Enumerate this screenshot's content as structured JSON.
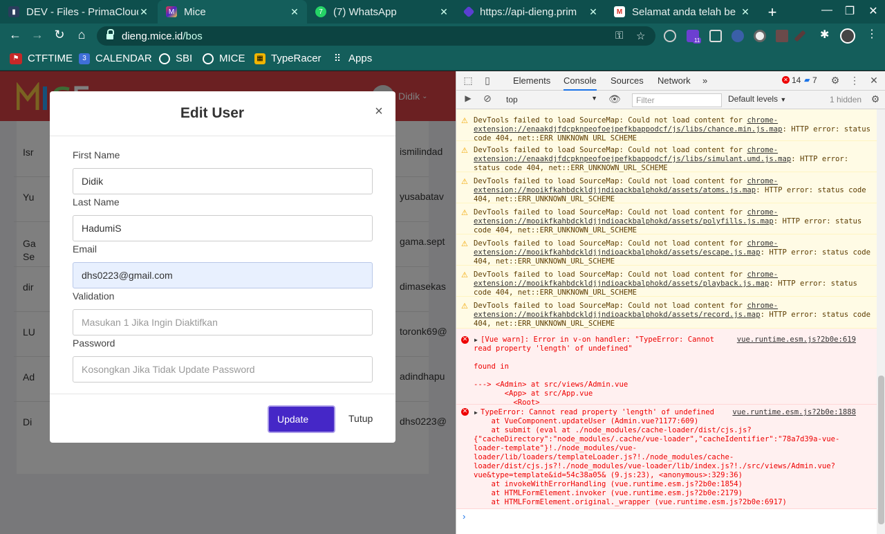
{
  "browser": {
    "tabs": [
      {
        "title": "DEV - Files - PrimaCloud",
        "favicon": "primacloud-icon",
        "active": false
      },
      {
        "title": "Mice",
        "favicon": "mice-logo-icon",
        "active": true
      },
      {
        "title": "(7) WhatsApp",
        "favicon": "whatsapp-icon",
        "active": false
      },
      {
        "title": "https://api-dieng.prim",
        "favicon": "api-icon",
        "active": false
      },
      {
        "title": "Selamat anda telah be",
        "favicon": "gmail-icon",
        "active": false
      }
    ],
    "new_tab": "+",
    "window_controls": {
      "minimize": "—",
      "maximize": "❐",
      "close": "✕"
    },
    "url_host": "dieng.mice.id",
    "url_path": "/bos",
    "extension_badge": "11",
    "bookmarks": [
      {
        "label": "CTFTIME",
        "icon": "ctftime-icon"
      },
      {
        "label": "CALENDAR",
        "icon": "calendar-icon",
        "badge": "3"
      },
      {
        "label": "SBI",
        "icon": "globe-icon"
      },
      {
        "label": "MICE",
        "icon": "globe-icon"
      },
      {
        "label": "TypeRacer",
        "icon": "typeracer-icon"
      },
      {
        "label": "Apps",
        "icon": "apps-grid-icon"
      }
    ]
  },
  "app": {
    "user_name": "Didik",
    "table_rows": [
      {
        "name": "Isr",
        "email": "ismilindad"
      },
      {
        "name": "Yu",
        "email": "yusabatav"
      },
      {
        "name": "Ga Se",
        "email": "gama.sept"
      },
      {
        "name": "dir",
        "email": "dimasekas"
      },
      {
        "name": "LU",
        "email": "toronk69@"
      },
      {
        "name": "Ad",
        "email": "adindhapu"
      },
      {
        "name": "Di",
        "email": "dhs0223@"
      }
    ]
  },
  "modal": {
    "title": "Edit User",
    "close": "×",
    "first_name_label": "First Name",
    "first_name_value": "Didik",
    "last_name_label": "Last Name",
    "last_name_value": "HadumiS",
    "email_label": "Email",
    "email_value": "dhs0223@gmail.com",
    "validation_label": "Validation",
    "validation_placeholder": "Masukan 1 Jika Ingin Diaktifkan",
    "password_label": "Password",
    "password_placeholder": "Kosongkan Jika Tidak Update Password",
    "update_button": "Update",
    "close_button": "Tutup"
  },
  "devtools": {
    "tabs": [
      "Elements",
      "Console",
      "Sources",
      "Network"
    ],
    "active_tab": "Console",
    "more_tabs": "»",
    "error_count": "14",
    "message_count": "7",
    "context": "top",
    "filter_placeholder": "Filter",
    "levels": "Default levels",
    "hidden": "1 hidden",
    "warnings": [
      {
        "text": "DevTools failed to load SourceMap: Could not load content for ",
        "link": "chrome-extension://enaakdjfdcpknpeofoejpefkbappodcf/js/libs/chance.min.js.map",
        "tail": ": HTTP error: status code 404, net::ERR_UNKNOWN_URL_SCHEME"
      },
      {
        "text": "DevTools failed to load SourceMap: Could not load content for ",
        "link": "chrome-extension://enaakdjfdcpknpeofoejpefkbappodcf/js/libs/simulant.umd.js.map",
        "tail": ": HTTP error: status code 404, net::ERR_UNKNOWN_URL_SCHEME"
      },
      {
        "text": "DevTools failed to load SourceMap: Could not load content for ",
        "link": "chrome-extension://mooikfkahbdckldjjndioackbalphokd/assets/atoms.js.map",
        "tail": ": HTTP error: status code 404, net::ERR_UNKNOWN_URL_SCHEME"
      },
      {
        "text": "DevTools failed to load SourceMap: Could not load content for ",
        "link": "chrome-extension://mooikfkahbdckldjjndioackbalphokd/assets/polyfills.js.map",
        "tail": ": HTTP error: status code 404, net::ERR_UNKNOWN_URL_SCHEME"
      },
      {
        "text": "DevTools failed to load SourceMap: Could not load content for ",
        "link": "chrome-extension://mooikfkahbdckldjjndioackbalphokd/assets/escape.js.map",
        "tail": ": HTTP error: status code 404, net::ERR_UNKNOWN_URL_SCHEME"
      },
      {
        "text": "DevTools failed to load SourceMap: Could not load content for ",
        "link": "chrome-extension://mooikfkahbdckldjjndioackbalphokd/assets/playback.js.map",
        "tail": ": HTTP error: status code 404, net::ERR_UNKNOWN_URL_SCHEME"
      },
      {
        "text": "DevTools failed to load SourceMap: Could not load content for ",
        "link": "chrome-extension://mooikfkahbdckldjjndioackbalphokd/assets/record.js.map",
        "tail": ": HTTP error: status code 404, net::ERR_UNKNOWN_URL_SCHEME"
      }
    ],
    "vue_warn": {
      "line1": "[Vue warn]: Error in v-on handler: \"TypeError: Cannot",
      "line2": "read property 'length' of undefined\"",
      "source": "vue.runtime.esm.js?2b0e:619",
      "found": "found in",
      "trace1": "---> <Admin> at src/views/Admin.vue",
      "trace2": "       <App> at src/App.vue",
      "trace3": "         <Root>"
    },
    "type_error": {
      "line1": "TypeError: Cannot read property 'length' of undefined",
      "source": "vue.runtime.esm.js?2b0e:1888",
      "stack": [
        "    at VueComponent.updateUser (Admin.vue?1177:609)",
        "    at submit (eval at ./node_modules/cache-loader/dist/cjs.js?",
        "{\"cacheDirectory\":\"node_modules/.cache/vue-loader\",\"cacheIdentifier\":\"78a7d39a-vue-",
        "loader-template\"}!./node_modules/vue-",
        "loader/lib/loaders/templateLoader.js?!./node_modules/cache-",
        "loader/dist/cjs.js?!./node_modules/vue-loader/lib/index.js?!./src/views/Admin.vue?",
        "vue&type=template&id=54c38a05& (9.js:23), <anonymous>:329:36)",
        "    at invokeWithErrorHandling (vue.runtime.esm.js?2b0e:1854)",
        "    at HTMLFormElement.invoker (vue.runtime.esm.js?2b0e:2179)",
        "    at HTMLFormElement.original._wrapper (vue.runtime.esm.js?2b0e:6917)"
      ]
    },
    "prompt": "›"
  },
  "colors": {
    "browser_frame": "#145e5b",
    "app_header": "#d64045",
    "update_button": "#4527c7"
  }
}
